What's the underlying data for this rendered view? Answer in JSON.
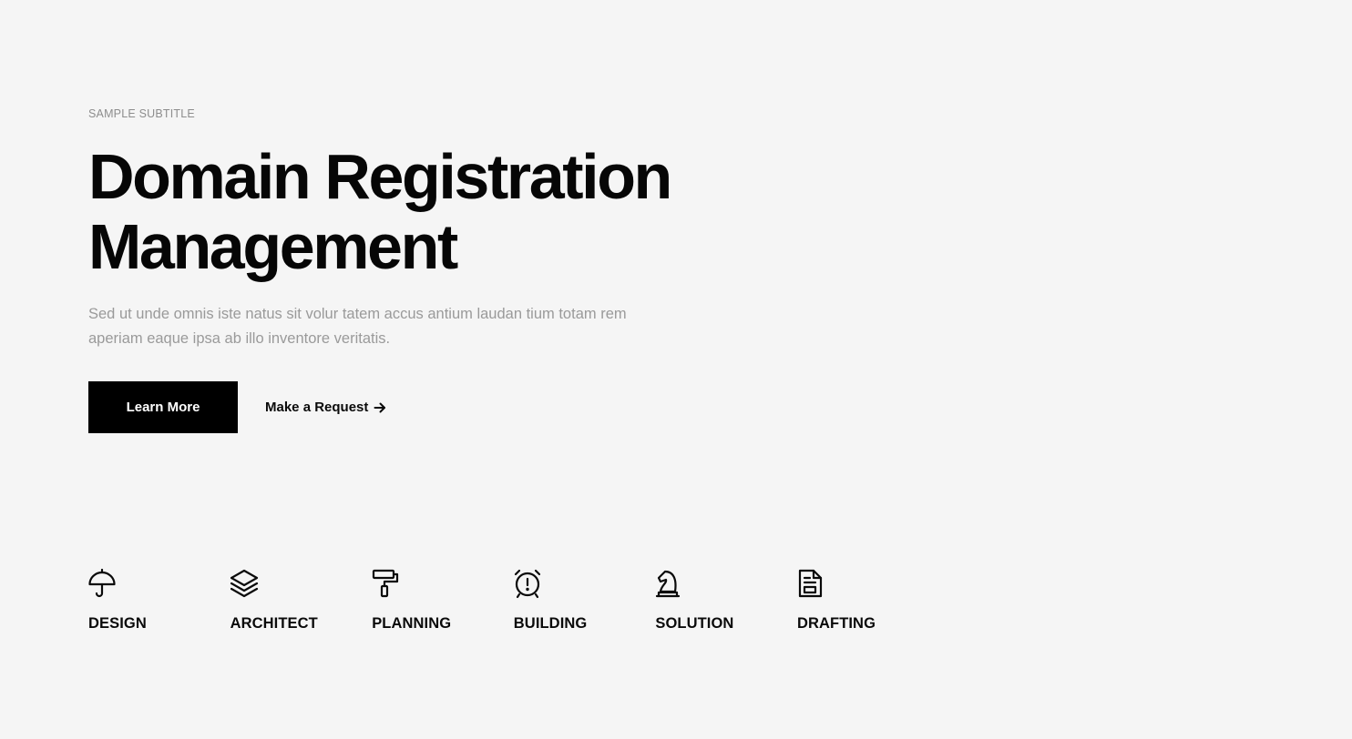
{
  "hero": {
    "subtitle": "SAMPLE SUBTITLE",
    "title_line1": "Domain Registration",
    "title_line2": "Management",
    "description": "Sed ut unde omnis iste natus sit volur tatem accus antium laudan tium totam rem aperiam eaque ipsa ab illo inventore veritatis.",
    "primary_button": "Learn More",
    "secondary_link": "Make a Request"
  },
  "features": [
    {
      "label": "DESIGN",
      "icon": "umbrella-icon"
    },
    {
      "label": "ARCHITECT",
      "icon": "layers-icon"
    },
    {
      "label": "PLANNING",
      "icon": "paint-roller-icon"
    },
    {
      "label": "BUILDING",
      "icon": "alarm-clock-icon"
    },
    {
      "label": "SOLUTION",
      "icon": "chess-knight-icon"
    },
    {
      "label": "DRAFTING",
      "icon": "document-icon"
    }
  ],
  "colors": {
    "background": "#f5f5f5",
    "text": "#0a0a0a",
    "muted": "#9a9a9a",
    "button_bg": "#000000",
    "button_text": "#ffffff"
  }
}
